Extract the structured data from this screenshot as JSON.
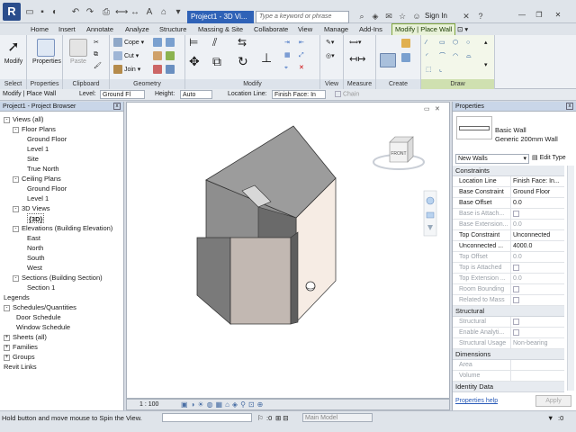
{
  "titlebar": {
    "doc_title": "Project1 - 3D Vi...",
    "search_placeholder": "Type a keyword or phrase",
    "sign_in": "Sign In"
  },
  "ribbon_tabs": [
    "Home",
    "Insert",
    "Annotate",
    "Analyze",
    "Structure",
    "Massing & Site",
    "Collaborate",
    "View",
    "Manage",
    "Add-Ins",
    "Modify | Place Wall"
  ],
  "ribbon": {
    "modify_label": "Modify",
    "properties_label": "Properties",
    "paste_label": "Paste",
    "cope_label": "Cope",
    "cut_label": "Cut",
    "join_label": "Join",
    "panels": {
      "select": "Select",
      "properties": "Properties",
      "clipboard": "Clipboard",
      "geometry": "Geometry",
      "modify": "Modify",
      "view": "View",
      "measure": "Measure",
      "create": "Create",
      "draw": "Draw"
    }
  },
  "optionsbar": {
    "context": "Modify | Place Wall",
    "level_label": "Level:",
    "level_value": "Ground Fl",
    "height_label": "Height:",
    "height_value": "Auto",
    "location_label": "Location Line:",
    "location_value": "Finish Face: In",
    "chain_label": "Chain"
  },
  "browser": {
    "title": "Project1 - Project Browser",
    "items": [
      {
        "label": "Views (all)",
        "toggle": "-"
      },
      {
        "label": "Floor Plans",
        "toggle": "-"
      },
      {
        "label": "Ground Floor",
        "toggle": ""
      },
      {
        "label": "Level 1",
        "toggle": ""
      },
      {
        "label": "Site",
        "toggle": ""
      },
      {
        "label": "True North",
        "toggle": ""
      },
      {
        "label": "Ceiling Plans",
        "toggle": "-"
      },
      {
        "label": "Ground Floor",
        "toggle": ""
      },
      {
        "label": "Level 1",
        "toggle": ""
      },
      {
        "label": "3D Views",
        "toggle": "-"
      },
      {
        "label": "{3D}",
        "toggle": ""
      },
      {
        "label": "Elevations (Building Elevation)",
        "toggle": "-"
      },
      {
        "label": "East",
        "toggle": ""
      },
      {
        "label": "North",
        "toggle": ""
      },
      {
        "label": "South",
        "toggle": ""
      },
      {
        "label": "West",
        "toggle": ""
      },
      {
        "label": "Sections (Building Section)",
        "toggle": "-"
      },
      {
        "label": "Section 1",
        "toggle": ""
      },
      {
        "label": "Legends",
        "toggle": ""
      },
      {
        "label": "Schedules/Quantities",
        "toggle": "-"
      },
      {
        "label": "Door Schedule",
        "toggle": ""
      },
      {
        "label": "Window Schedule",
        "toggle": ""
      },
      {
        "label": "Sheets (all)",
        "toggle": "+"
      },
      {
        "label": "Families",
        "toggle": "+"
      },
      {
        "label": "Groups",
        "toggle": "+"
      },
      {
        "label": "Revit Links",
        "toggle": ""
      }
    ]
  },
  "viewport": {
    "viewcube_label": "FRONT",
    "scale": "1 : 100"
  },
  "properties": {
    "title": "Properties",
    "type_family": "Basic Wall",
    "type_name": "Generic 200mm Wall",
    "instance_filter": "New Walls",
    "edit_type": "Edit Type",
    "groups": {
      "constraints": "Constraints",
      "structural": "Structural",
      "dimensions": "Dimensions",
      "identity": "Identity Data"
    },
    "constraints": [
      {
        "k": "Location Line",
        "v": "Finish Face: In...",
        "dim": false
      },
      {
        "k": "Base Constraint",
        "v": "Ground Floor",
        "dim": false
      },
      {
        "k": "Base Offset",
        "v": "0.0",
        "dim": false
      },
      {
        "k": "Base is Attach...",
        "v": "",
        "dim": true
      },
      {
        "k": "Base Extension...",
        "v": "0.0",
        "dim": true
      },
      {
        "k": "Top Constraint",
        "v": "Unconnected",
        "dim": false
      },
      {
        "k": "Unconnected ...",
        "v": "4000.0",
        "dim": false
      },
      {
        "k": "Top Offset",
        "v": "0.0",
        "dim": true
      },
      {
        "k": "Top is Attached",
        "v": "",
        "dim": true
      },
      {
        "k": "Top Extension ...",
        "v": "0.0",
        "dim": true
      },
      {
        "k": "Room Bounding",
        "v": "",
        "dim": true
      },
      {
        "k": "Related to Mass",
        "v": "",
        "dim": true
      }
    ],
    "structural": [
      {
        "k": "Structural",
        "v": "",
        "dim": true
      },
      {
        "k": "Enable Analyti...",
        "v": "",
        "dim": true
      },
      {
        "k": "Structural Usage",
        "v": "Non-bearing",
        "dim": true
      }
    ],
    "dimensions": [
      {
        "k": "Area",
        "v": "",
        "dim": true
      },
      {
        "k": "Volume",
        "v": "",
        "dim": true
      }
    ],
    "help_link": "Properties help",
    "apply": "Apply"
  },
  "statusbar": {
    "message": "Hold button and move mouse to Spin the View.",
    "coord": ":0",
    "model": "Main Model"
  }
}
